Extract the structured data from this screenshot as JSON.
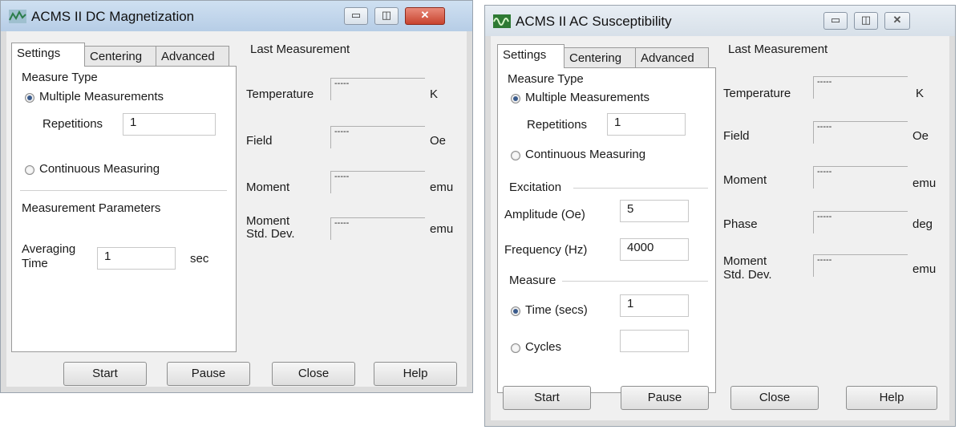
{
  "dc": {
    "title": "ACMS II DC Magnetization",
    "tabs": [
      "Settings",
      "Centering",
      "Advanced"
    ],
    "measure_type": "Measure Type",
    "multiple": "Multiple Measurements",
    "repetitions_label": "Repetitions",
    "repetitions_value": "1",
    "continuous": "Continuous Measuring",
    "params": "Measurement Parameters",
    "averaging_1": "Averaging",
    "averaging_2": "Time",
    "averaging_value": "1",
    "averaging_unit": "sec",
    "last": "Last Measurement",
    "readouts": [
      {
        "label": "Temperature",
        "value": "-----",
        "unit": "K"
      },
      {
        "label": "Field",
        "value": "-----",
        "unit": "Oe"
      },
      {
        "label": "Moment",
        "value": "-----",
        "unit": "emu"
      },
      {
        "label": "Moment",
        "label2": "Std. Dev.",
        "value": "-----",
        "unit": "emu"
      }
    ],
    "buttons": {
      "start": "Start",
      "pause": "Pause",
      "close": "Close",
      "help": "Help"
    },
    "titlebar": {
      "minimize": "▭",
      "maximize": "◫",
      "close": "✕"
    }
  },
  "ac": {
    "title": "ACMS II AC Susceptibility",
    "tabs": [
      "Settings",
      "Centering",
      "Advanced"
    ],
    "measure_type": "Measure Type",
    "multiple": "Multiple Measurements",
    "repetitions_label": "Repetitions",
    "repetitions_value": "1",
    "continuous": "Continuous Measuring",
    "excitation": "Excitation",
    "amplitude_label": "Amplitude (Oe)",
    "amplitude_value": "5",
    "frequency_label": "Frequency (Hz)",
    "frequency_value": "4000",
    "measure": "Measure",
    "time_label": "Time (secs)",
    "time_value": "1",
    "cycles_label": "Cycles",
    "cycles_value": "",
    "last": "Last Measurement",
    "readouts": [
      {
        "label": "Temperature",
        "value": "-----",
        "unit": "K"
      },
      {
        "label": "Field",
        "value": "-----",
        "unit": "Oe"
      },
      {
        "label": "Moment",
        "value": "-----",
        "unit": "emu"
      },
      {
        "label": "Phase",
        "value": "-----",
        "unit": "deg"
      },
      {
        "label": "Moment",
        "label2": "Std. Dev.",
        "value": "-----",
        "unit": "emu"
      }
    ],
    "buttons": {
      "start": "Start",
      "pause": "Pause",
      "close": "Close",
      "help": "Help"
    },
    "titlebar": {
      "minimize": "▭",
      "maximize": "◫",
      "close": "✕"
    }
  },
  "colors": {
    "close_red": "#c8432e",
    "selection": "#3a5b8c"
  }
}
